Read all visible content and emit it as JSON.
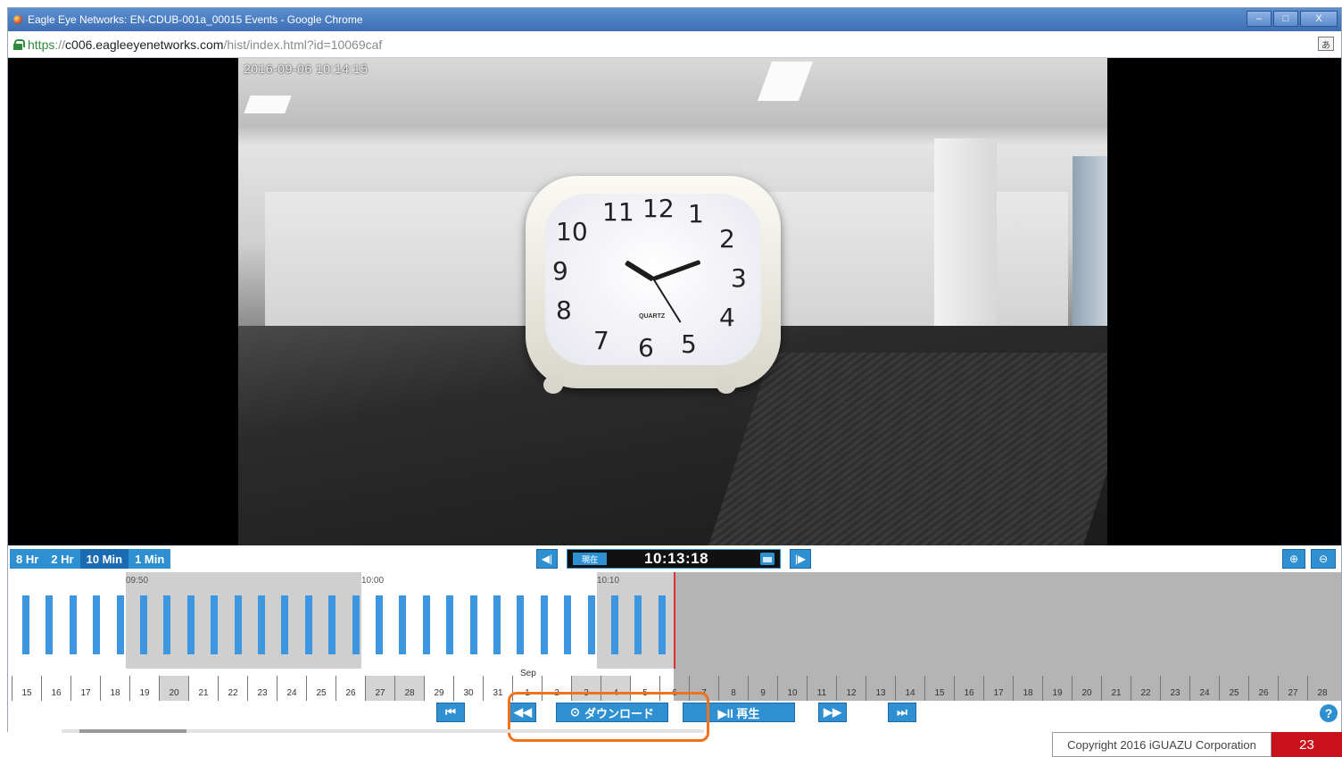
{
  "window": {
    "title": "Eagle Eye Networks: EN-CDUB-001a_00015 Events - Google Chrome",
    "minimize": "–",
    "maximize": "□",
    "close": "X"
  },
  "address": {
    "scheme": "https",
    "separator": "://",
    "host": "c006.eagleeyenetworks.com",
    "path": "/hist/index.html?id=10069caf"
  },
  "video": {
    "timestamp": "2016-09-06 10:14:15",
    "clock_numbers": [
      "12",
      "1",
      "2",
      "3",
      "4",
      "5",
      "6",
      "7",
      "8",
      "9",
      "10",
      "11"
    ],
    "clock_brand": "QUARTZ"
  },
  "toolbar": {
    "zoom_tabs": [
      "8 Hr",
      "2 Hr",
      "10 Min",
      "1 Min"
    ],
    "active_zoom": "10 Min",
    "live_label": "現在",
    "current_time": "10:13:18",
    "prev_icon": "skip-previous-icon",
    "next_icon": "skip-next-icon",
    "zoom_in_icon": "zoom-in-icon",
    "zoom_out_icon": "zoom-out-icon"
  },
  "timeline": {
    "time_labels": [
      "09:50",
      "10:00",
      "10:10"
    ],
    "days_aug": [
      "15",
      "16",
      "17",
      "18",
      "19",
      "20",
      "21",
      "22",
      "23",
      "24",
      "25",
      "26",
      "27",
      "28",
      "29",
      "30",
      "31"
    ],
    "month_label": "Sep",
    "days_sep": [
      "1",
      "2",
      "3",
      "4",
      "5",
      "6",
      "7",
      "8",
      "9",
      "10",
      "11",
      "12",
      "13",
      "14",
      "15",
      "16",
      "17",
      "18",
      "19",
      "20",
      "21",
      "22",
      "23",
      "24",
      "25",
      "26",
      "27",
      "28"
    ]
  },
  "playback": {
    "download_label": "ダウンロード",
    "play_label": "▶ll 再生",
    "first_glyph": "⏮",
    "rewind_glyph": "◀◀",
    "forward_glyph": "▶▶",
    "last_glyph": "⏭",
    "help_glyph": "?"
  },
  "footer": {
    "copyright": "Copyright 2016 iGUAZU Corporation",
    "page_number": "23"
  },
  "colors": {
    "accent": "#2e8fd1",
    "highlight": "#f2711c",
    "footer_red": "#c9111c"
  }
}
